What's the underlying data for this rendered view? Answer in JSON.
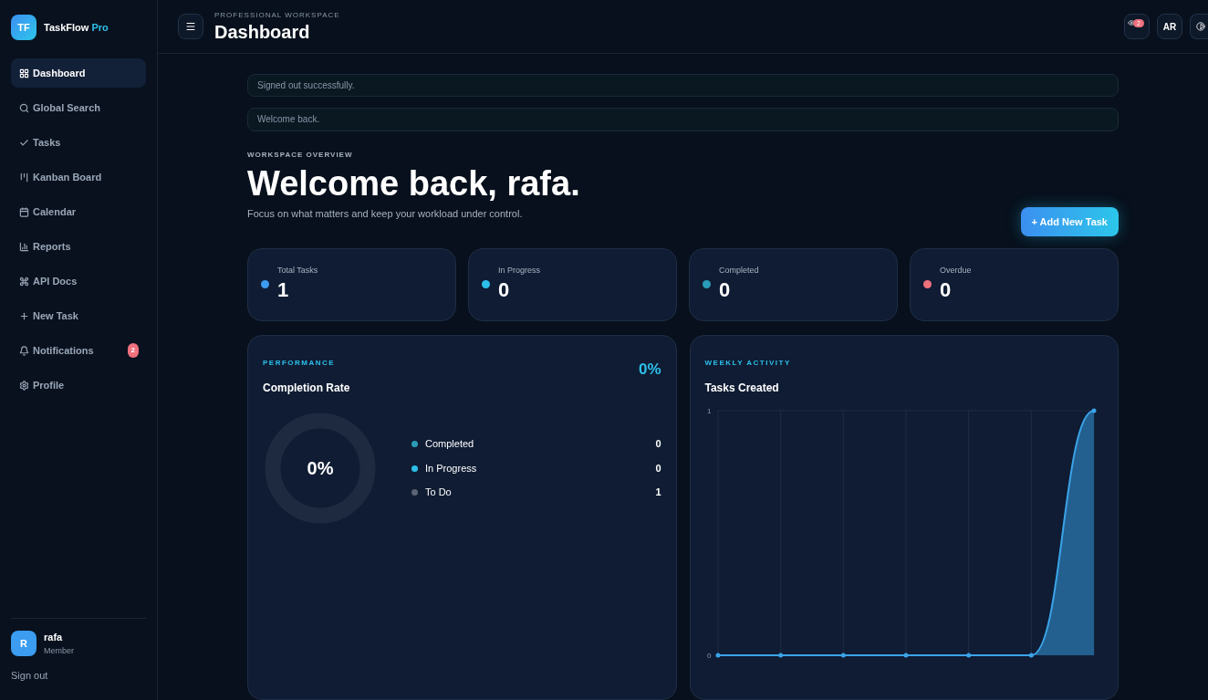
{
  "brand": {
    "logo": "TF",
    "name": "TaskFlow",
    "accent": "Pro"
  },
  "nav": [
    {
      "label": "Dashboard",
      "selected": true
    },
    {
      "label": "Global Search",
      "selected": false
    },
    {
      "label": "Tasks",
      "selected": false
    },
    {
      "label": "Kanban Board",
      "selected": false
    },
    {
      "label": "Calendar",
      "selected": false
    },
    {
      "label": "Reports",
      "selected": false
    },
    {
      "label": "API Docs",
      "selected": false
    },
    {
      "label": "New Task",
      "selected": false
    },
    {
      "label": "Notifications",
      "selected": false,
      "badge": "2"
    },
    {
      "label": "Profile",
      "selected": false
    }
  ],
  "user": {
    "initial": "R",
    "name": "rafa",
    "role": "Member",
    "signout": "Sign out"
  },
  "header": {
    "eyebrow": "PROFESSIONAL WORKSPACE",
    "title": "Dashboard",
    "notif_badge": "2",
    "lang": "AR"
  },
  "alerts": [
    "Signed out successfully.",
    "Welcome back."
  ],
  "hero": {
    "eyebrow": "WORKSPACE OVERVIEW",
    "title": "Welcome back, rafa.",
    "subtitle": "Focus on what matters and keep your workload under control.",
    "button": "+ Add New Task"
  },
  "stats": [
    {
      "label": "Total Tasks",
      "value": "1",
      "color": "#3b9cf0"
    },
    {
      "label": "In Progress",
      "value": "0",
      "color": "#2cc0ea"
    },
    {
      "label": "Completed",
      "value": "0",
      "color": "#2a9cb8"
    },
    {
      "label": "Overdue",
      "value": "0",
      "color": "#f0707e"
    }
  ],
  "performance": {
    "eyebrow": "PERFORMANCE",
    "title": "Completion Rate",
    "percent": "0%",
    "center": "0%",
    "level": 0,
    "legend": [
      {
        "label": "Completed",
        "value": "0",
        "color": "#2a9cb8"
      },
      {
        "label": "In Progress",
        "value": "0",
        "color": "#2cc0ea"
      },
      {
        "label": "To Do",
        "value": "1",
        "color": "#5a6474"
      }
    ]
  },
  "activity": {
    "eyebrow": "WEEKLY ACTIVITY",
    "title": "Tasks Created",
    "chart_data": {
      "type": "area",
      "grid": true,
      "ylim": [
        0,
        1
      ],
      "yticks": [
        0,
        1
      ],
      "series": [
        {
          "color": "#3ba3e8",
          "values": [
            0,
            0,
            0,
            0,
            0,
            0,
            1
          ]
        }
      ]
    }
  }
}
